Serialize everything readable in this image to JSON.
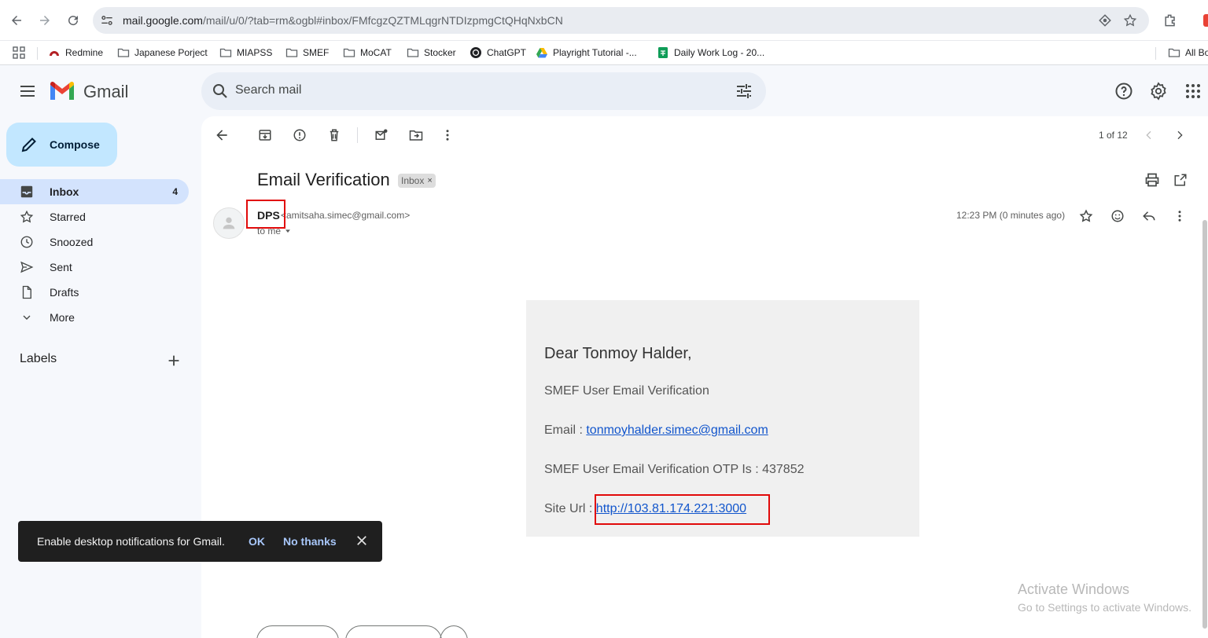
{
  "browser": {
    "url_host": "mail.google.com",
    "url_path": "/mail/u/0/?tab=rm&ogbl#inbox/FMfcgzQZTMLqgrNTDIzpmgCtQHqNxbCN"
  },
  "bookmarks": [
    {
      "label": "Redmine",
      "icon": "redmine-icon"
    },
    {
      "label": "Japanese Porject",
      "icon": "folder-icon"
    },
    {
      "label": "MIAPSS",
      "icon": "folder-icon"
    },
    {
      "label": "SMEF",
      "icon": "folder-icon"
    },
    {
      "label": "MoCAT",
      "icon": "folder-icon"
    },
    {
      "label": "Stocker",
      "icon": "folder-icon"
    },
    {
      "label": "ChatGPT",
      "icon": "chatgpt-icon"
    },
    {
      "label": "Playright Tutorial -...",
      "icon": "drive-icon"
    },
    {
      "label": "Daily Work Log - 20...",
      "icon": "sheets-icon"
    },
    {
      "label": "All Bo",
      "icon": "folder-icon"
    }
  ],
  "gmail": {
    "brand": "Gmail",
    "search_placeholder": "Search mail",
    "compose_label": "Compose"
  },
  "nav": [
    {
      "label": "Inbox",
      "count": "4",
      "icon": "inbox-icon",
      "active": true
    },
    {
      "label": "Starred",
      "count": "",
      "icon": "star-icon"
    },
    {
      "label": "Snoozed",
      "count": "",
      "icon": "clock-icon"
    },
    {
      "label": "Sent",
      "count": "",
      "icon": "send-icon"
    },
    {
      "label": "Drafts",
      "count": "",
      "icon": "draft-icon"
    },
    {
      "label": "More",
      "count": "",
      "icon": "chevron-down-icon"
    }
  ],
  "labels_heading": "Labels",
  "toolbar": {
    "pager": "1 of 12"
  },
  "message": {
    "subject": "Email Verification",
    "inbox_chip": "Inbox",
    "sender_name": "DPS",
    "sender_email": "<amitsaha.simec@gmail.com>",
    "to": "to me",
    "timestamp": "12:23 PM (0 minutes ago)",
    "body": {
      "greeting": "Dear Tonmoy Halder,",
      "line1": "SMEF User Email Verification",
      "email_label": "Email : ",
      "email_link": "tonmoyhalder.simec@gmail.com",
      "otp_line": "SMEF User Email Verification OTP Is : 437852",
      "site_label": "Site Url : ",
      "site_link": "http://103.81.174.221:3000"
    }
  },
  "snackbar": {
    "text": "Enable desktop notifications for Gmail.",
    "ok": "OK",
    "no_thanks": "No thanks"
  },
  "watermark": {
    "line1": "Activate Windows",
    "line2": "Go to Settings to activate Windows."
  }
}
